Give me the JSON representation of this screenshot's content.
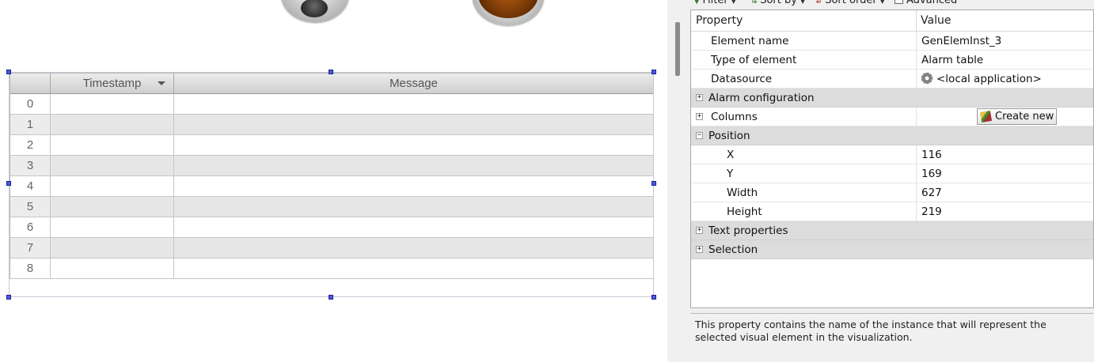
{
  "toolbar": {
    "filter_label": "Filter",
    "sort_by_label": "Sort by",
    "sort_order_label": "Sort order",
    "advanced_label": "Advanced"
  },
  "alarm_table": {
    "columns": [
      "Timestamp",
      "Message"
    ],
    "row_indices": [
      "0",
      "1",
      "2",
      "3",
      "4",
      "5",
      "6",
      "7",
      "8"
    ]
  },
  "properties": {
    "header": {
      "property": "Property",
      "value": "Value"
    },
    "rows": [
      {
        "name": "Element name",
        "value": "GenElemInst_3"
      },
      {
        "name": "Type of element",
        "value": "Alarm table"
      },
      {
        "name": "Datasource",
        "value": "<local application>"
      },
      {
        "name": "Alarm configuration",
        "value": ""
      },
      {
        "name": "Columns",
        "value": "Create new"
      },
      {
        "name": "Position",
        "value": ""
      },
      {
        "name": "X",
        "value": "116"
      },
      {
        "name": "Y",
        "value": "169"
      },
      {
        "name": "Width",
        "value": "627"
      },
      {
        "name": "Height",
        "value": "219"
      },
      {
        "name": "Text properties",
        "value": ""
      },
      {
        "name": "Selection",
        "value": ""
      }
    ],
    "expanders": {
      "collapsed": "+",
      "expanded": "−"
    }
  },
  "description": "This property contains the name of the instance that will represent the selected visual element in the visualization.",
  "icons": {
    "datasource": "gear-icon",
    "create_new": "wand-icon",
    "sort_caret": "chevron-down-icon"
  },
  "colors": {
    "selection_handle": "#4a5ae0",
    "category_row": "#dcdcdc",
    "alt_row": "#e6e6e6"
  }
}
